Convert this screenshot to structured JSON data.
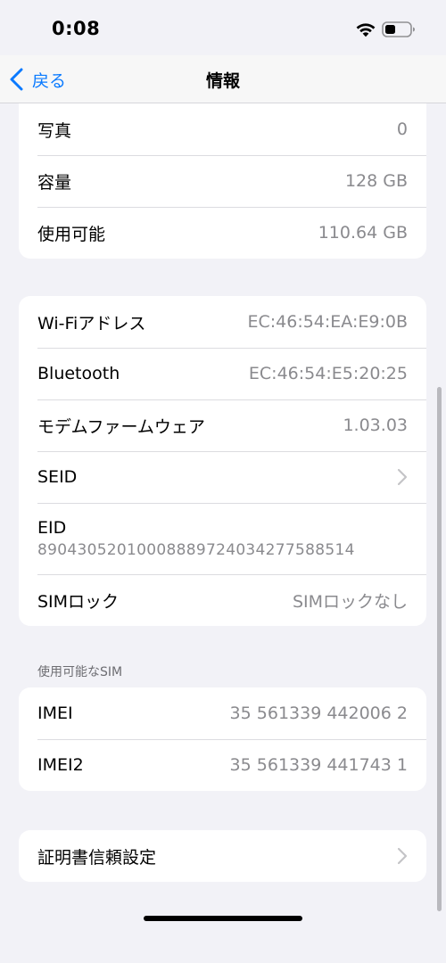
{
  "status_bar": {
    "time": "0:08"
  },
  "nav": {
    "back_label": "戻る",
    "title": "情報"
  },
  "storage_group": [
    {
      "label": "写真",
      "value": "0"
    },
    {
      "label": "容量",
      "value": "128 GB"
    },
    {
      "label": "使用可能",
      "value": "110.64 GB"
    }
  ],
  "network_group": {
    "wifi": {
      "label": "Wi-Fiアドレス",
      "value": "EC:46:54:EA:E9:0B"
    },
    "bluetooth": {
      "label": "Bluetooth",
      "value": "EC:46:54:E5:20:25"
    },
    "modem": {
      "label": "モデムファームウェア",
      "value": "1.03.03"
    },
    "seid": {
      "label": "SEID"
    },
    "eid": {
      "label": "EID",
      "value": "89043052010008889724034277588514"
    },
    "sim_lock": {
      "label": "SIMロック",
      "value": "SIMロックなし"
    }
  },
  "sim_section": {
    "header": "使用可能なSIM",
    "rows": [
      {
        "label": "IMEI",
        "value": "35 561339 442006 2"
      },
      {
        "label": "IMEI2",
        "value": "35 561339 441743 1"
      }
    ]
  },
  "certificate": {
    "label": "証明書信頼設定"
  },
  "colors": {
    "accent": "#0a7aff",
    "background": "#f2f2f7",
    "secondary_text": "#8a8a8e"
  }
}
